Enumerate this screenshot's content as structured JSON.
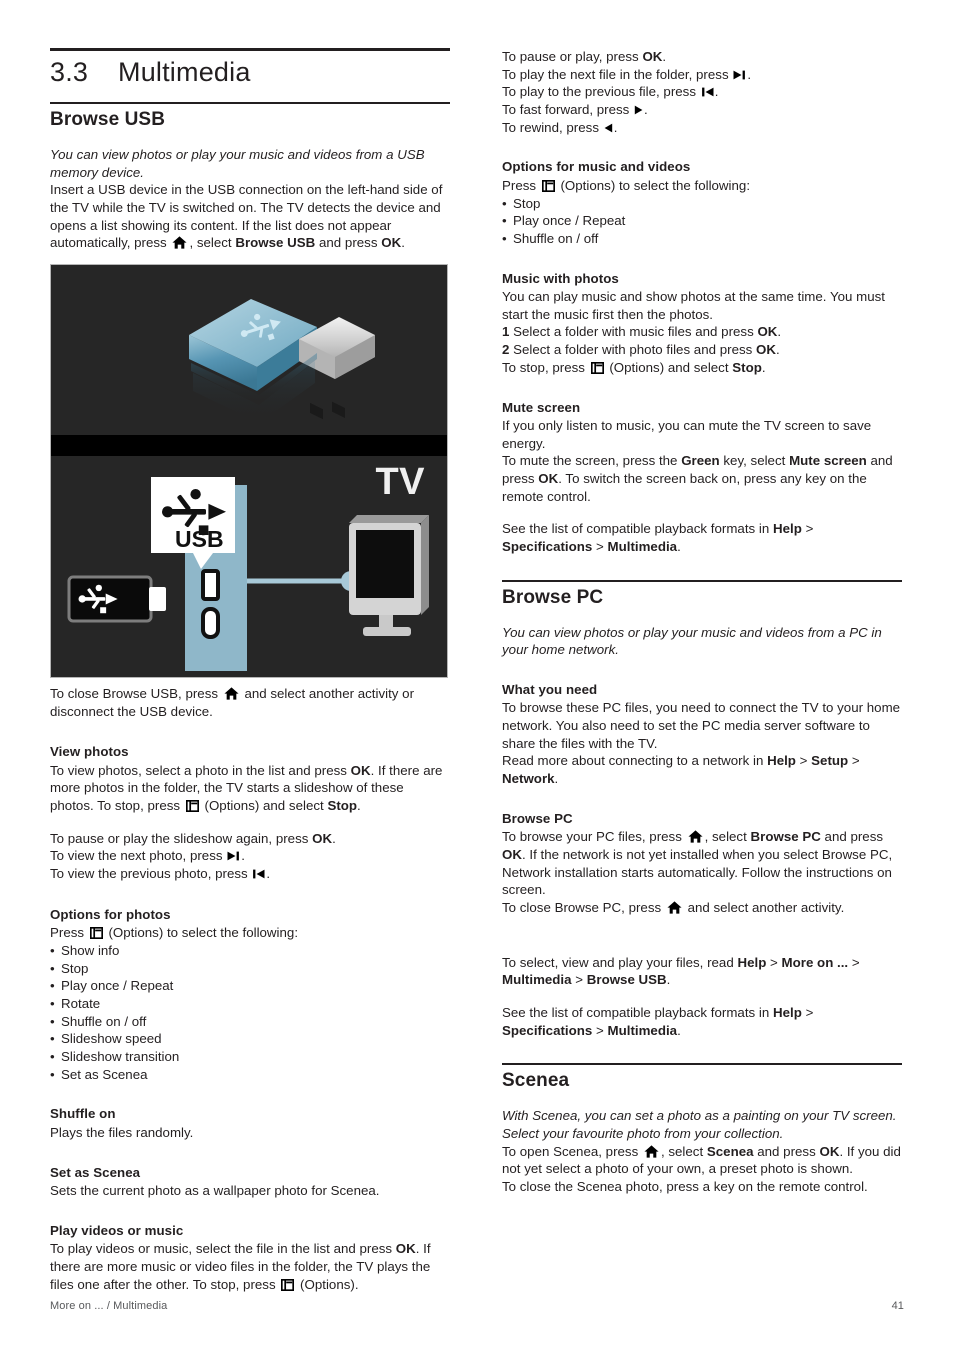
{
  "chapter": {
    "number": "3.3",
    "title": "Multimedia"
  },
  "footer": {
    "left": "More on ... / Multimedia",
    "page": "41"
  },
  "figure": {
    "tv_label": "TV",
    "usb_label": "USB",
    "alt": "USB memory stick and USB connection on the left-hand side of the TV"
  },
  "left": {
    "browse_usb": {
      "heading": "Browse USB",
      "intro_italic": "You can view photos or play your music and videos from a USB memory device.",
      "p1_a": "Insert a USB device in the USB connection on the left-hand side of the TV while the TV is switched on. The TV detects the device and opens a list showing its content. If the list does not appear automatically, press",
      "p1_b": ", select",
      "p1_bold1": "Browse USB",
      "p1_c": "and press",
      "p1_bold2": "OK",
      "p1_end": ".",
      "after_fig_a": "To close Browse USB, press",
      "after_fig_b": "and select another activity or disconnect the USB device."
    },
    "view_photos": {
      "heading": "View photos",
      "p1_a": "To view photos, select a photo in the list and press",
      "p1_bold1": "OK",
      "p1_b": ". If there are more photos in the folder, the TV starts a slideshow of these photos. To stop, press",
      "p1_c": "(Options) and select",
      "p1_bold2": "Stop",
      "p1_end": ".",
      "p2_a": "To pause or play the slideshow again, press",
      "p2_bold": "OK",
      "p2_end": ".",
      "p3_a": "To view the next photo, press",
      "p3_end": ".",
      "p4_a": "To view the previous photo, press",
      "p4_end": "."
    },
    "options_photos": {
      "heading": "Options for photos",
      "press_a": "Press",
      "press_b": "(Options) to select the following:",
      "items": [
        "Show info",
        "Stop",
        "Play once / Repeat",
        "Rotate",
        "Shuffle on / off",
        "Slideshow speed",
        "Slideshow transition",
        "Set as Scenea"
      ]
    },
    "shuffle_on": {
      "heading": "Shuffle on",
      "body": "Plays the files randomly."
    },
    "set_as_scenea": {
      "heading": "Set as Scenea",
      "body": "Sets the current photo as a wallpaper photo for Scenea."
    },
    "play_videos": {
      "heading": "Play videos or music",
      "p_a": "To play videos or music, select the file in the list and press",
      "p_bold": "OK",
      "p_b": ". If there are more music or video files in the folder, the TV plays the files one after the other. To stop, press",
      "p_c": "(Options)."
    }
  },
  "right": {
    "playback_keys": {
      "l1_a": "To pause or play, press",
      "l1_bold": "OK",
      "l1_end": ".",
      "l2_a": "To play the next file in the folder, press",
      "l2_end": ".",
      "l3_a": "To play to the previous file, press",
      "l3_end": ".",
      "l4_a": "To fast forward, press",
      "l4_end": ".",
      "l5_a": "To rewind, press",
      "l5_end": "."
    },
    "options_music_videos": {
      "heading": "Options for music and videos",
      "press_a": "Press",
      "press_b": "(Options) to select the following:",
      "items": [
        "Stop",
        "Play once / Repeat",
        "Shuffle on / off"
      ]
    },
    "music_with_photos": {
      "heading": "Music with photos",
      "p1": "You can play music and show photos at the same time. You must start the music first then the photos.",
      "step1_num": "1",
      "step1_a": "Select a folder with music files and press",
      "step1_bold": "OK",
      "step1_end": ".",
      "step2_num": "2",
      "step2_a": "Select a folder with photo files and press",
      "step2_bold": "OK",
      "step2_end": ".",
      "stop_a": "To stop, press",
      "stop_b": "(Options) and select",
      "stop_bold": "Stop",
      "stop_end": "."
    },
    "mute_screen": {
      "heading": "Mute screen",
      "p1": "If you only listen to music, you can mute the TV screen to save energy.",
      "p2_a": "To mute the screen, press the",
      "p2_bold1": "Green",
      "p2_b": "key, select",
      "p2_bold2": "Mute screen",
      "p2_c": "and press",
      "p2_bold3": "OK",
      "p2_d": ". To switch the screen back on, press any key on the remote control."
    },
    "formats_note_1": {
      "a": "See the list of compatible playback formats in",
      "bold1": "Help",
      "gt1": ">",
      "bold2": "Specifications",
      "gt2": ">",
      "bold3": "Multimedia",
      "end": "."
    },
    "browse_pc": {
      "heading": "Browse PC",
      "intro_italic": "You can view photos or play your music and videos from a PC in your home network.",
      "what_you_need": {
        "heading": "What you need",
        "p1": "To browse these PC files, you need to connect the TV to your home network. You also need to set the PC media server software to share the files with the TV.",
        "p2_a": "Read more about connecting to a network in",
        "p2_bold1": "Help",
        "p2_gt1": ">",
        "p2_bold2": "Setup",
        "p2_gt2": ">",
        "p2_bold3": "Network",
        "p2_end": "."
      },
      "browse_sub": {
        "heading": "Browse PC",
        "p1_a": "To browse your PC files, press",
        "p1_b": ", select",
        "p1_bold1": "Browse PC",
        "p1_c": "and press",
        "p1_bold2": "OK",
        "p1_d": ". If the network is not yet installed when you select Browse PC, Network installation starts automatically. Follow the instructions on screen.",
        "p2_a": "To close Browse PC, press",
        "p2_b": "and select another activity."
      },
      "select_view_note": {
        "a": "To select, view and play your files, read",
        "bold1": "Help",
        "gt1": ">",
        "bold2": "More on ...",
        "gt2": ">",
        "bold3": "Multimedia",
        "gt3": ">",
        "bold4": "Browse USB",
        "end": "."
      }
    },
    "formats_note_2": {
      "a": "See the list of compatible playback formats in",
      "bold1": "Help",
      "gt1": ">",
      "bold2": "Specifications",
      "gt2": ">",
      "bold3": "Multimedia",
      "end": "."
    },
    "scenea": {
      "heading": "Scenea",
      "intro_italic": "With Scenea, you can set a photo as a painting on your TV screen. Select your favourite photo from your collection.",
      "p1_a": "To open Scenea, press",
      "p1_b": ", select",
      "p1_bold1": "Scenea",
      "p1_c": "and press",
      "p1_bold2": "OK",
      "p1_d": ". If you did not yet select a photo of your own, a preset photo is shown.",
      "p2": "To close the Scenea photo, press a key on the remote control."
    }
  }
}
